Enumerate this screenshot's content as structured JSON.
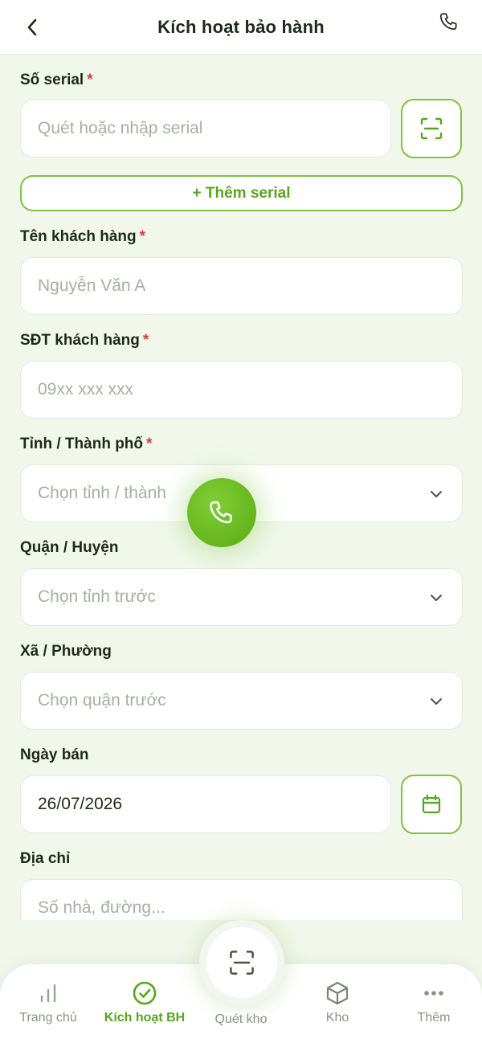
{
  "header": {
    "title": "Kích hoạt bảo hành"
  },
  "form": {
    "serial": {
      "label": "Số serial",
      "required": "*",
      "placeholder": "Quét hoặc nhập serial"
    },
    "add_serial": "+ Thêm serial",
    "customer_name": {
      "label": "Tên khách hàng",
      "required": "*",
      "placeholder": "Nguyễn Văn A"
    },
    "customer_phone": {
      "label": "SĐT khách hàng",
      "required": "*",
      "placeholder": "09xx xxx xxx"
    },
    "province": {
      "label": "Tỉnh / Thành phố",
      "required": "*",
      "placeholder": "Chọn tỉnh / thành"
    },
    "district": {
      "label": "Quận / Huyện",
      "placeholder": "Chọn tỉnh trước"
    },
    "ward": {
      "label": "Xã / Phường",
      "placeholder": "Chọn quận trước"
    },
    "sale_date": {
      "label": "Ngày bán",
      "value": "26/07/2026"
    },
    "address": {
      "label": "Địa chỉ",
      "placeholder": "Số nhà, đường..."
    }
  },
  "nav": {
    "items": [
      {
        "label": "Trang chủ",
        "icon": "bar-chart-icon"
      },
      {
        "label": "Kích hoạt BH",
        "icon": "check-circle-icon",
        "active": true
      },
      {
        "label": "Quét kho",
        "icon": "scan-icon"
      },
      {
        "label": "Kho",
        "icon": "box-icon"
      },
      {
        "label": "Thêm",
        "icon": "more-icon"
      }
    ]
  },
  "colors": {
    "accent": "#7ec43e",
    "accent_dark": "#58a51b",
    "background": "#f1f7ea",
    "required": "#d63b3b"
  }
}
